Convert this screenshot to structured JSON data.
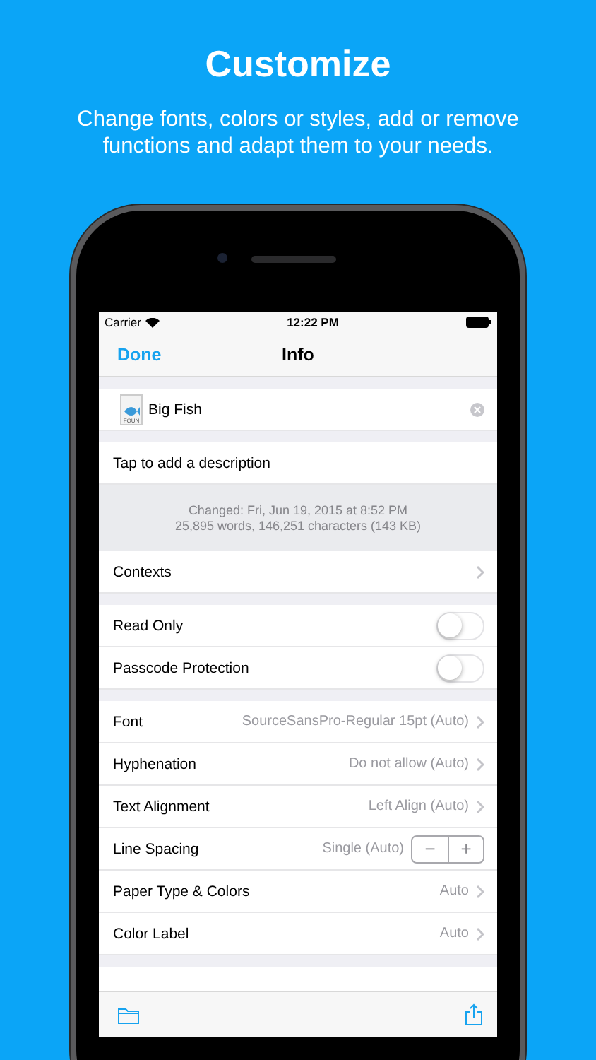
{
  "headline": "Customize",
  "subtitle": "Change fonts, colors or styles, add or remove functions and adapt them to your needs.",
  "status_bar": {
    "carrier": "Carrier",
    "time": "12:22 PM"
  },
  "nav": {
    "done": "Done",
    "title": "Info"
  },
  "document": {
    "name": "Big Fish",
    "thumb_label": "FOUN"
  },
  "description": {
    "placeholder": "Tap to add a description"
  },
  "stats": [
    "Changed: Fri, Jun 19, 2015 at 8:52 PM",
    "25,895 words, 146,251 characters (143 KB)"
  ],
  "sections": [
    [
      {
        "kind": "detail",
        "label": "Contexts"
      }
    ],
    [
      {
        "kind": "toggle",
        "label": "Read Only",
        "on": false
      },
      {
        "kind": "toggle",
        "label": "Passcode Protection",
        "on": false
      }
    ],
    [
      {
        "kind": "detail",
        "label": "Font",
        "value": "SourceSansPro-Regular 15pt (Auto)"
      },
      {
        "kind": "detail",
        "label": "Hyphenation",
        "value": "Do not allow (Auto)"
      },
      {
        "kind": "detail",
        "label": "Text Alignment",
        "value": "Left Align (Auto)"
      },
      {
        "kind": "stepper",
        "label": "Line Spacing",
        "value": "Single (Auto)",
        "minus": "−",
        "plus": "+"
      },
      {
        "kind": "detail",
        "label": "Paper Type & Colors",
        "value": "Auto"
      },
      {
        "kind": "detail",
        "label": "Color Label",
        "value": "Auto"
      }
    ]
  ]
}
